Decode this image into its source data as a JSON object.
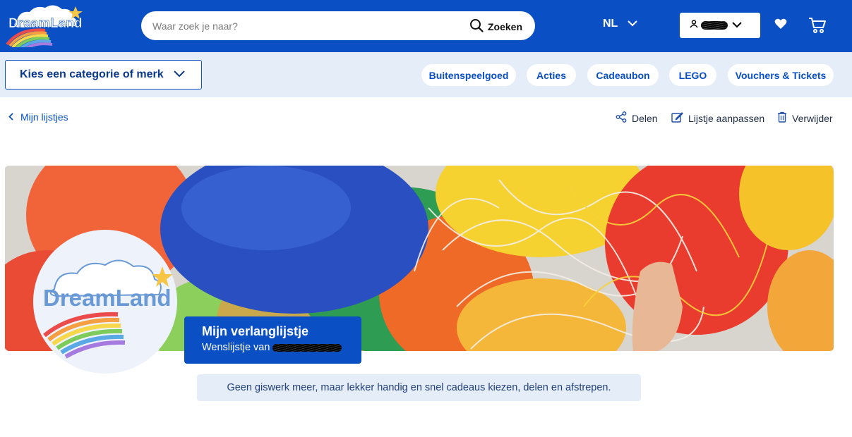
{
  "brand": {
    "logo_text": "DreamLand",
    "colors": {
      "primary": "#0a4fc4",
      "light": "#e5edf8"
    }
  },
  "search": {
    "placeholder": "Waar zoek je naar?",
    "button_label": "Zoeken",
    "icon": "search-icon"
  },
  "header": {
    "language": "NL"
  },
  "category_bar": {
    "category_button": "Kies een categorie of merk",
    "links": [
      "Buitenspeelgoed",
      "Acties",
      "Cadeaubon",
      "LEGO",
      "Vouchers & Tickets"
    ]
  },
  "toolbar": {
    "back_label": "Mijn lijstjes",
    "share_label": "Delen",
    "edit_label": "Lijstje aanpassen",
    "delete_label": "Verwijder"
  },
  "wishlist": {
    "title": "Mijn verlanglijstje",
    "subtitle_prefix": "Wenslijstje van",
    "description": "Geen giswerk meer, maar lekker handig en snel cadeaus kiezen, delen en afstrepen."
  }
}
